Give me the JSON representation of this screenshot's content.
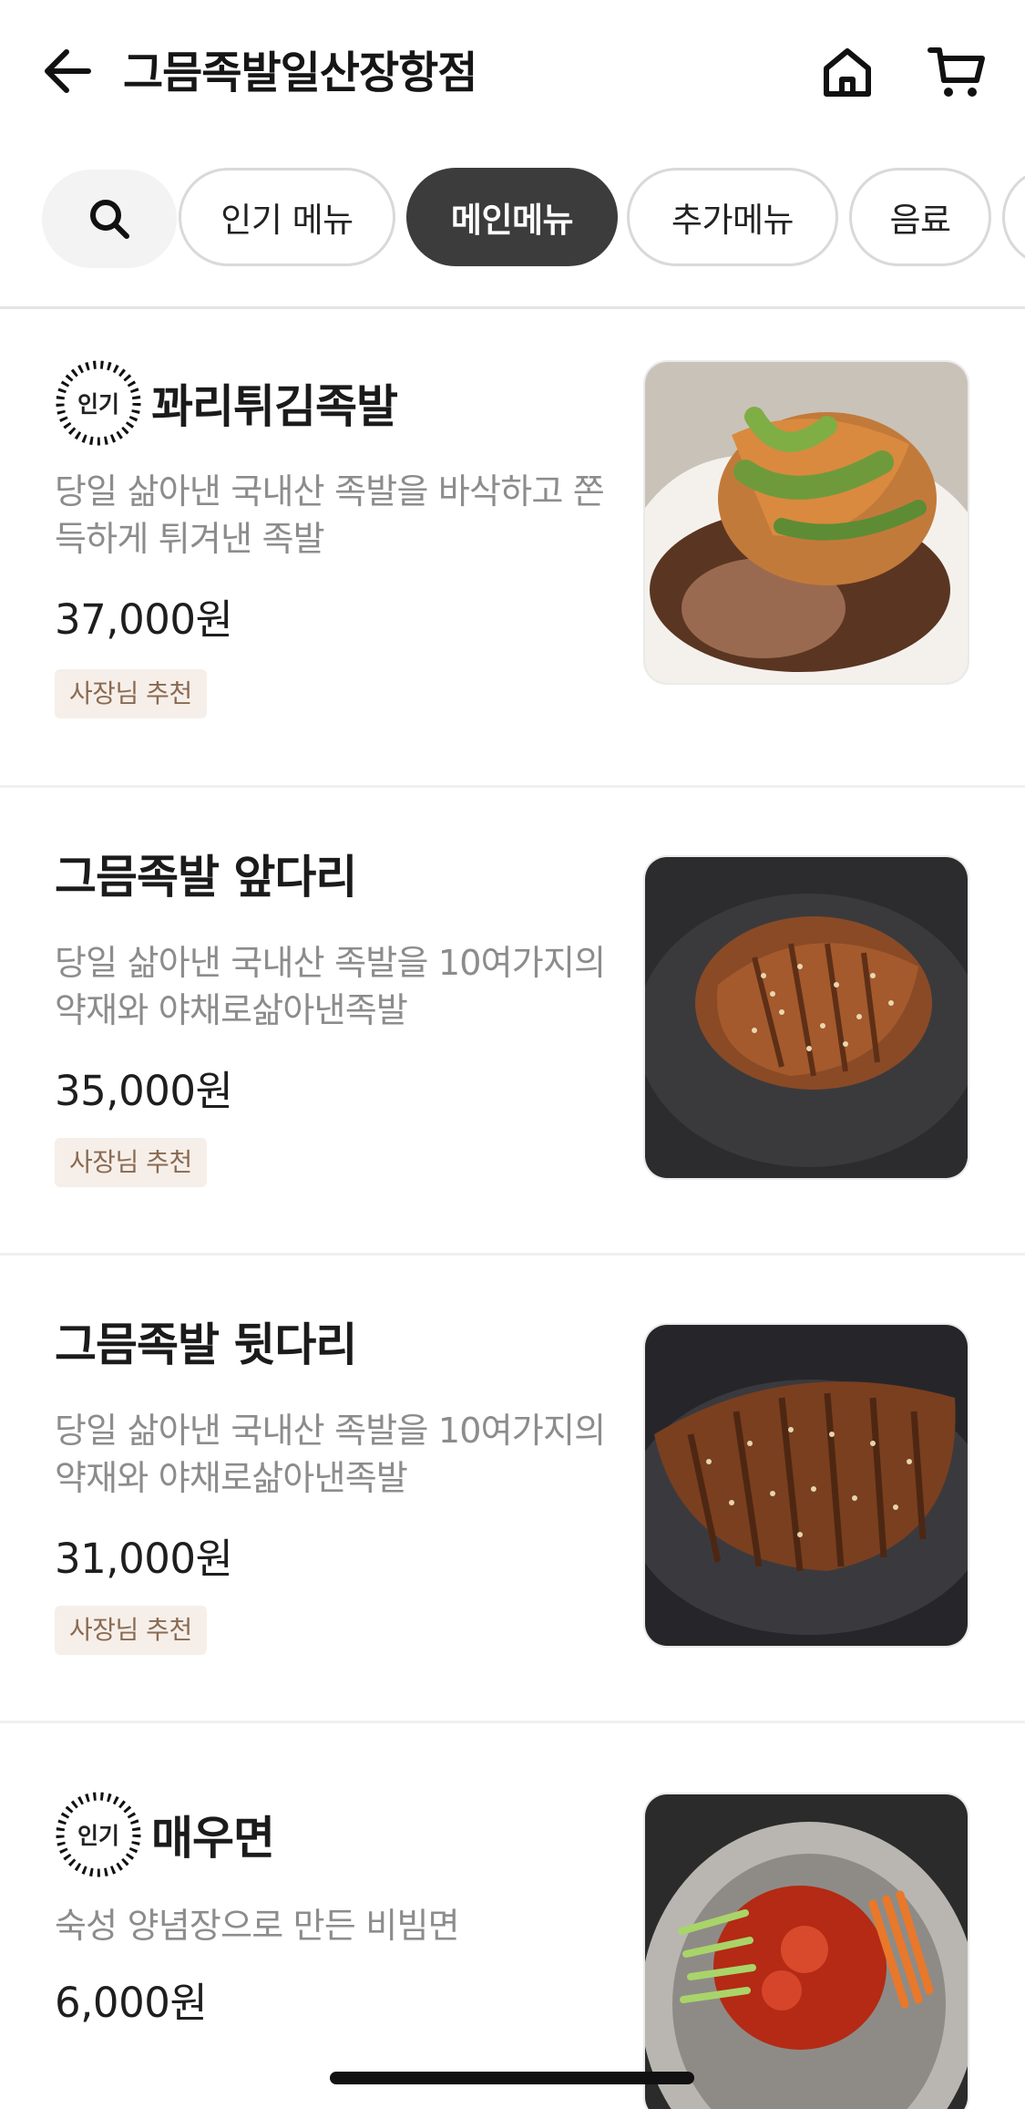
{
  "header": {
    "store_name": "그믐족발일산장항점"
  },
  "categories": [
    {
      "label": "인기 메뉴",
      "active": false
    },
    {
      "label": "메인메뉴",
      "active": true
    },
    {
      "label": "추가메뉴",
      "active": false
    },
    {
      "label": "음료",
      "active": false
    }
  ],
  "menu_items": [
    {
      "popular_badge": "인기",
      "name": "꽈리튀김족발",
      "description": "당일 삶아낸 국내산 족발을 바삭하고 쫀득하게 튀겨낸 족발",
      "price": "37,000원",
      "recommend_badge": "사장님 추천"
    },
    {
      "name": "그믐족발 앞다리",
      "description": "당일 삶아낸 국내산 족발을 10여가지의 약재와 야채로삶아낸족발",
      "price": "35,000원",
      "recommend_badge": "사장님 추천"
    },
    {
      "name": "그믐족발 뒷다리",
      "description": "당일 삶아낸 국내산 족발을 10여가지의 약재와 야채로삶아낸족발",
      "price": "31,000원",
      "recommend_badge": "사장님 추천"
    },
    {
      "popular_badge": "인기",
      "name": "매우면",
      "description": "숙성 양념장으로 만든 비빔면",
      "price": "6,000원"
    }
  ],
  "icons": {
    "back": "arrow-left-icon",
    "home": "home-icon",
    "cart": "cart-icon",
    "search": "search-icon"
  },
  "colors": {
    "active_chip": "#3c3c3c",
    "recommend_bg": "#f6efe9",
    "recommend_text": "#8a6a52",
    "description": "#8c8c8c"
  }
}
